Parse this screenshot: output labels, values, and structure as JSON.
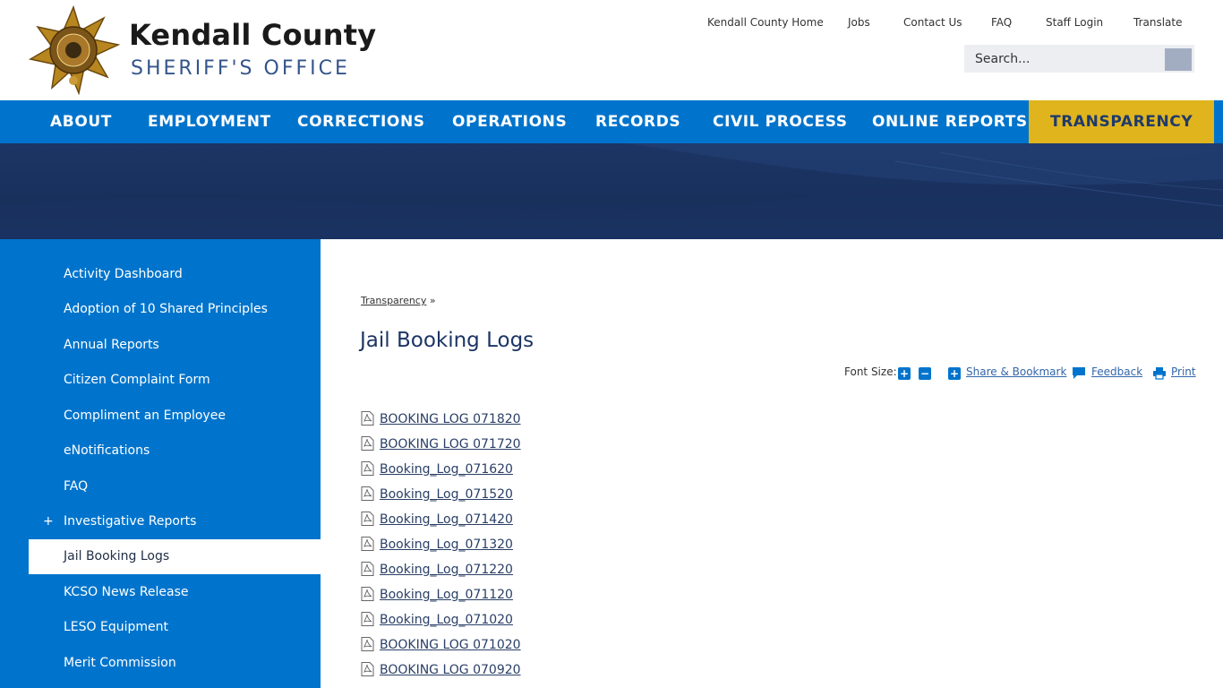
{
  "header": {
    "title_line1": "Kendall County",
    "title_line2": "SHERIFF'S OFFICE",
    "utility_nav": [
      "Kendall County Home",
      "Jobs",
      "Contact Us",
      "FAQ",
      "Staff Login",
      "Translate"
    ],
    "search_placeholder": "Search..."
  },
  "main_nav": [
    "ABOUT",
    "EMPLOYMENT",
    "CORRECTIONS",
    "OPERATIONS",
    "RECORDS",
    "CIVIL PROCESS",
    "ONLINE REPORTS",
    "TRANSPARENCY"
  ],
  "sidebar": {
    "items": [
      {
        "label": "Activity Dashboard",
        "expandable": false,
        "active": false
      },
      {
        "label": "Adoption of 10 Shared Principles",
        "expandable": false,
        "active": false
      },
      {
        "label": "Annual Reports",
        "expandable": false,
        "active": false
      },
      {
        "label": "Citizen Complaint Form",
        "expandable": false,
        "active": false
      },
      {
        "label": "Compliment an Employee",
        "expandable": false,
        "active": false
      },
      {
        "label": "eNotifications",
        "expandable": false,
        "active": false
      },
      {
        "label": "FAQ",
        "expandable": false,
        "active": false
      },
      {
        "label": "Investigative Reports",
        "expandable": true,
        "active": false
      },
      {
        "label": "Jail Booking Logs",
        "expandable": false,
        "active": true
      },
      {
        "label": "KCSO News Release",
        "expandable": false,
        "active": false
      },
      {
        "label": "LESO Equipment",
        "expandable": false,
        "active": false
      },
      {
        "label": "Merit Commission",
        "expandable": false,
        "active": false
      }
    ],
    "expand_symbol": "+"
  },
  "content": {
    "breadcrumb_link": "Transparency",
    "breadcrumb_sep": "»",
    "title": "Jail Booking Logs",
    "tools": {
      "font_size_label": "Font Size:",
      "increase": "+",
      "decrease": "−",
      "share_label": "Share & Bookmark",
      "feedback_label": "Feedback",
      "print_label": "Print"
    },
    "documents": [
      "BOOKING LOG 071820",
      "BOOKING LOG 071720",
      "Booking_Log_071620",
      "Booking_Log_071520",
      "Booking_Log_071420",
      "Booking_Log_071320",
      "Booking_Log_071220",
      "Booking_Log_071120",
      "Booking_Log_071020",
      "BOOKING LOG 071020",
      "BOOKING LOG 070920"
    ]
  },
  "colors": {
    "nav_blue": "#0074cc",
    "transparency_gold": "#e0b41d",
    "banner_navy": "#1d3564",
    "title_navy": "#1d3564"
  }
}
